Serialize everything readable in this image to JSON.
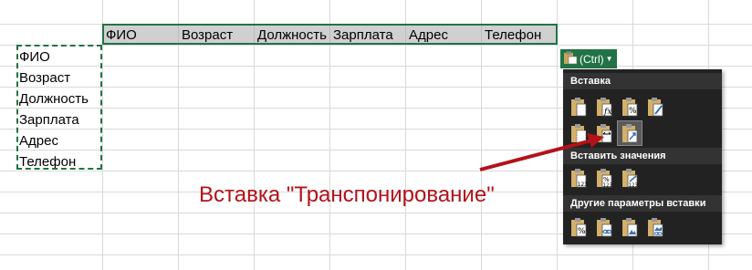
{
  "header_row": [
    "ФИО",
    "Возраст",
    "Должность",
    "Зарплата",
    "Адрес",
    "Телефон"
  ],
  "column_cells": [
    "ФИО",
    "Возраст",
    "Должность",
    "Зарплата",
    "Адрес",
    "Телефон"
  ],
  "paste_options": {
    "button_label": "(Ctrl)",
    "sections": [
      "Вставка",
      "Вставить значения",
      "Другие параметры вставки"
    ]
  },
  "caption": "Вставка \"Транспонирование\"",
  "colors": {
    "accent": "#217346",
    "menu_bg": "#222222",
    "section_bg": "#333333",
    "caption": "#b3121a"
  }
}
